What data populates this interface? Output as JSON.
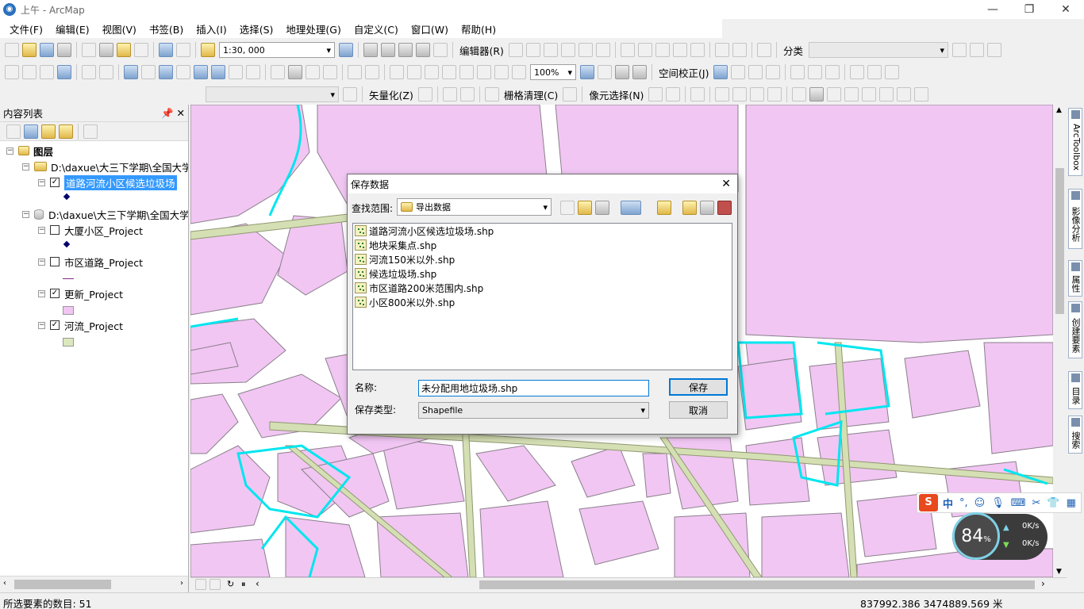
{
  "window": {
    "title": "上午 - ArcMap"
  },
  "menu": [
    "文件(F)",
    "编辑(E)",
    "视图(V)",
    "书签(B)",
    "插入(I)",
    "选择(S)",
    "地理处理(G)",
    "自定义(C)",
    "窗口(W)",
    "帮助(H)"
  ],
  "toolbar1": {
    "scale": "1:30, 000",
    "editor": "编辑器(R)",
    "classify": "分类"
  },
  "toolbar2": {
    "zoom": "100%",
    "georef": "空间校正(J)"
  },
  "toolbar3": {
    "vectorize": "矢量化(Z)",
    "raster_cleanup": "栅格清理(C)",
    "cell_select": "像元选择(N)"
  },
  "toc": {
    "title": "内容列表",
    "root": "图层",
    "group1": "D:\\daxue\\大三下学期\\全国大学",
    "layer_selected": "道路河流小区候选垃圾场",
    "group2": "D:\\daxue\\大三下学期\\全国大学",
    "layers": [
      "大厦小区_Project",
      "市区道路_Project",
      "更新_Project",
      "河流_Project"
    ]
  },
  "right_tabs": [
    "ArcToolbox",
    "影像分析",
    "属性",
    "创建要素",
    "目录",
    "搜索"
  ],
  "dialog": {
    "title": "保存数据",
    "lookin_label": "查找范围:",
    "lookin_value": "导出数据",
    "files": [
      "道路河流小区候选垃圾场.shp",
      "地块采集点.shp",
      "河流150米以外.shp",
      "候选垃圾场.shp",
      "市区道路200米范围内.shp",
      "小区800米以外.shp"
    ],
    "name_label": "名称:",
    "name_value": "未分配用地垃圾场.shp",
    "type_label": "保存类型:",
    "type_value": "Shapefile",
    "save": "保存",
    "cancel": "取消"
  },
  "status": {
    "selected": "所选要素的数目: 51",
    "coords": "837992.386  3474889.569 米"
  },
  "ime": {
    "lang": "中"
  },
  "network": {
    "percent": "84",
    "unit": "%",
    "up": "0K/s",
    "down": "0K/s"
  },
  "colors": {
    "parcel": "#f1c6f3",
    "river": "#00e6ef",
    "road": "#d5dfb4",
    "accent": "#0078d7",
    "selection": "#3399ff"
  }
}
